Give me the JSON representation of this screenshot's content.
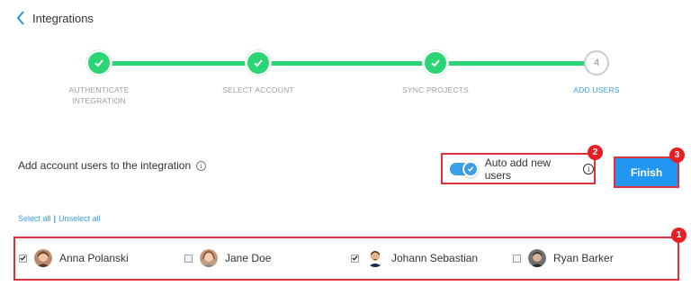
{
  "header": {
    "back_label": "Integrations"
  },
  "stepper": {
    "steps": [
      {
        "label_line1": "AUTHENTICATE",
        "label_line2": "INTEGRATION",
        "state": "done"
      },
      {
        "label_line1": "SELECT ACCOUNT",
        "label_line2": "",
        "state": "done"
      },
      {
        "label_line1": "SYNC PROJECTS",
        "label_line2": "",
        "state": "done"
      },
      {
        "label_line1": "ADD USERS",
        "label_line2": "",
        "state": "current",
        "number": "4"
      }
    ],
    "colors": {
      "done": "#2bd576",
      "active_label": "#3b9ee8"
    }
  },
  "section": {
    "title": "Add account users to the integration",
    "info_icon": "i"
  },
  "auto_add": {
    "label": "Auto add new users",
    "enabled": true,
    "info_icon": "i"
  },
  "finish": {
    "label": "Finish"
  },
  "annotations": {
    "badge_users": "1",
    "badge_toggle": "2",
    "badge_finish": "3",
    "color": "#e81e25"
  },
  "selection": {
    "select_all": "Select all",
    "separator": "|",
    "unselect_all": "Unselect all"
  },
  "users": [
    {
      "name": "Anna Polanski",
      "checked": true
    },
    {
      "name": "Jane Doe",
      "checked": false
    },
    {
      "name": "Johann Sebastian",
      "checked": true
    },
    {
      "name": "Ryan Barker",
      "checked": false
    }
  ],
  "accent": "#2196f3"
}
